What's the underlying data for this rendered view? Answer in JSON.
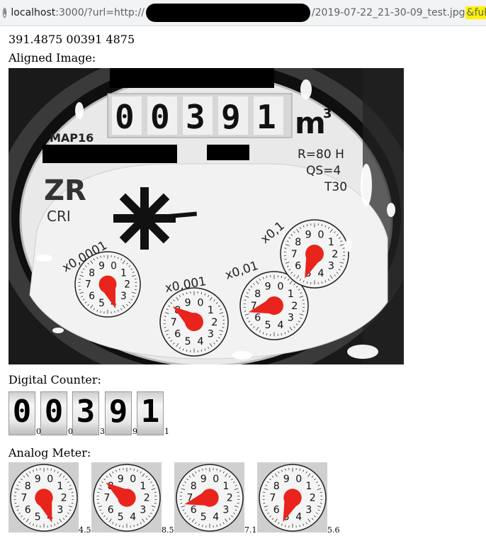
{
  "browser": {
    "url_host": "localhost",
    "url_port_path": ":3000/?url=http://",
    "url_tail": "/2019-07-22_21-30-09_test.jpg",
    "url_highlight": "&full"
  },
  "result": {
    "summary": "391.4875 00391 4875",
    "aligned_label": "Aligned Image:",
    "digital_label": "Digital Counter:",
    "analog_label": "Analog Meter:"
  },
  "meter": {
    "counter_digits": [
      "0",
      "0",
      "3",
      "9",
      "1"
    ],
    "unit": "m",
    "unit_exp": "3",
    "model": "MAP16",
    "spec_lines": [
      "R=80 H",
      "QS=4",
      "T30"
    ],
    "brand": "ZR",
    "brand_sub": "CRI",
    "dial_factors": [
      "x0,0001",
      "x0,001",
      "x0,01",
      "x0,1"
    ]
  },
  "digital_counter": {
    "digits": [
      "0",
      "0",
      "3",
      "9",
      "1"
    ],
    "values": [
      "0",
      "0",
      "3",
      "9",
      "1"
    ]
  },
  "analog_meter": {
    "values": [
      "4.5",
      "8.5",
      "7.1",
      "5.6"
    ]
  },
  "colors": {
    "pointer": "#e8241c",
    "redaction": "#000000",
    "highlight": "#fff200"
  }
}
